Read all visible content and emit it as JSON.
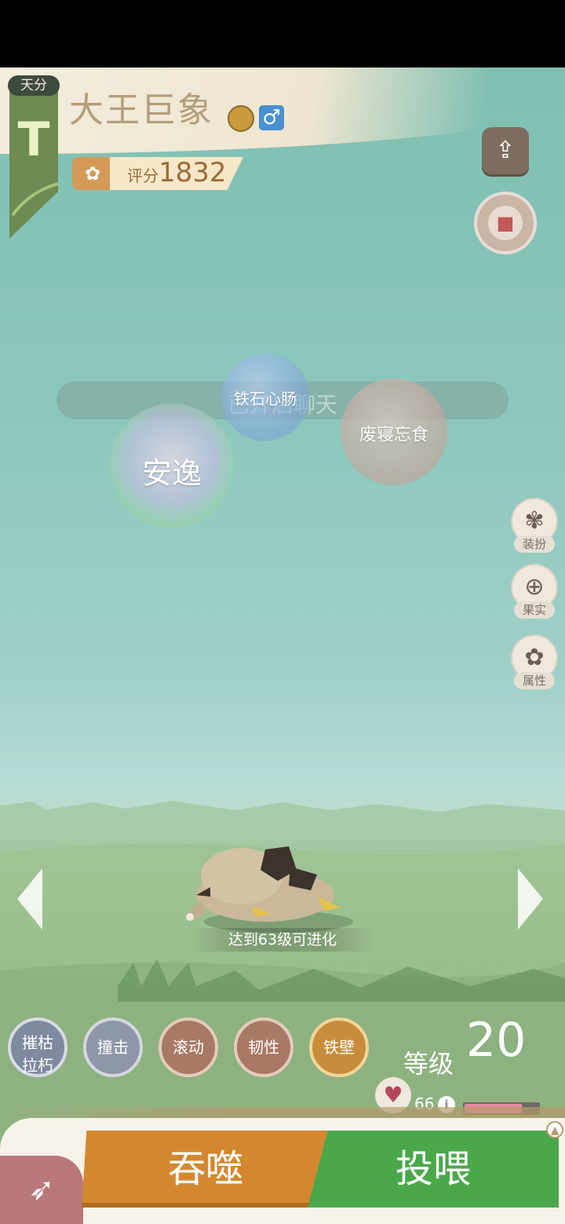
{
  "header": {
    "tier_tag": "天分",
    "tier_letter": "T",
    "pet_name": "大王巨象",
    "gender_symbol": "♂",
    "score_label": "评分",
    "score_value": "1832"
  },
  "top_right": {
    "share_icon": "share-icon",
    "lock_icon": "lock-icon"
  },
  "chat": {
    "placeholder": "已开启聊天"
  },
  "bubbles": [
    {
      "label": "铁石心肠",
      "color": "#9dbbe0"
    },
    {
      "label": "安逸",
      "color": "rainbow"
    },
    {
      "label": "废寝忘食",
      "color": "#c9a39a"
    }
  ],
  "side_menu": [
    {
      "label": "装扮",
      "icon": "butterfly-icon"
    },
    {
      "label": "果实",
      "icon": "plus-icon"
    },
    {
      "label": "属性",
      "icon": "paw-icon"
    }
  ],
  "pet": {
    "evolve_tip": "达到63级可进化"
  },
  "skills": [
    {
      "label_line1": "摧枯",
      "label_line2": "拉朽",
      "color": "#7f8aa0"
    },
    {
      "label_line1": "撞击",
      "label_line2": "",
      "color": "#8e97a7"
    },
    {
      "label_line1": "滚动",
      "label_line2": "",
      "color": "#a87965"
    },
    {
      "label_line1": "韧性",
      "label_line2": "",
      "color": "#a87965"
    },
    {
      "label_line1": "铁壁",
      "label_line2": "",
      "color": "#c88d3c"
    }
  ],
  "level": {
    "label": "等级",
    "value": "20"
  },
  "affinity": {
    "value": "66",
    "bar_fraction": 0.78
  },
  "actions": {
    "devour": "吞噬",
    "feed": "投喂"
  }
}
